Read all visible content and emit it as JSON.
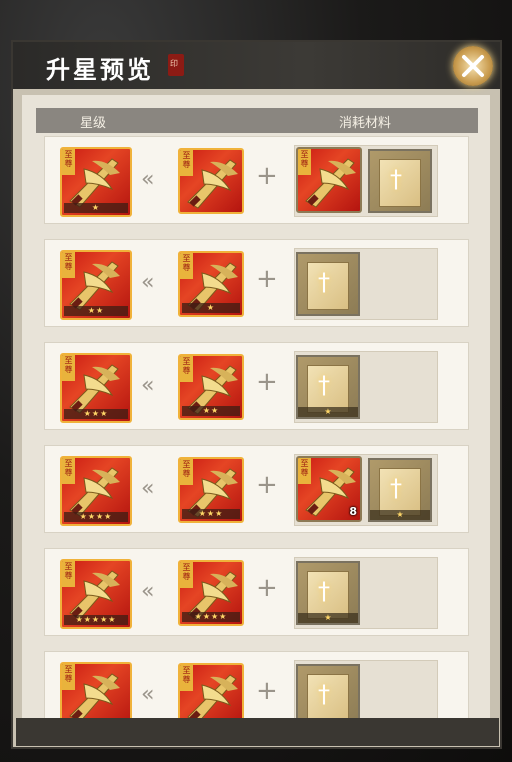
{
  "dialog": {
    "title": "升星预览",
    "seal_text": "印",
    "close_label": "✕"
  },
  "table": {
    "col_star": "星级",
    "col_materials": "消耗材料"
  },
  "card_tag": "至尊",
  "rows": [
    {
      "result_stars": "★",
      "base_stars": "",
      "materials": [
        {
          "type": "card",
          "stars": "",
          "count": ""
        },
        {
          "type": "token",
          "stars": ""
        }
      ]
    },
    {
      "result_stars": "★★",
      "base_stars": "★",
      "materials": [
        {
          "type": "token",
          "stars": ""
        }
      ]
    },
    {
      "result_stars": "★★★",
      "base_stars": "★★",
      "materials": [
        {
          "type": "token",
          "stars": "★"
        }
      ]
    },
    {
      "result_stars": "★★★★",
      "base_stars": "★★★",
      "materials": [
        {
          "type": "card",
          "stars": "",
          "count": "8"
        },
        {
          "type": "token",
          "stars": "★"
        }
      ]
    },
    {
      "result_stars": "★★★★★",
      "base_stars": "★★★★",
      "materials": [
        {
          "type": "token",
          "stars": "★"
        }
      ]
    },
    {
      "result_stars": "",
      "base_stars": "",
      "materials": [
        {
          "type": "token",
          "stars": ""
        }
      ]
    }
  ],
  "colors": {
    "accent_gold": "#f0b23a",
    "card_red": "#c91b13",
    "panel_bg": "#e8e3d8"
  },
  "icons": {
    "arrow": "double-chevron-left-icon",
    "plus": "plus-icon",
    "close": "close-icon"
  }
}
